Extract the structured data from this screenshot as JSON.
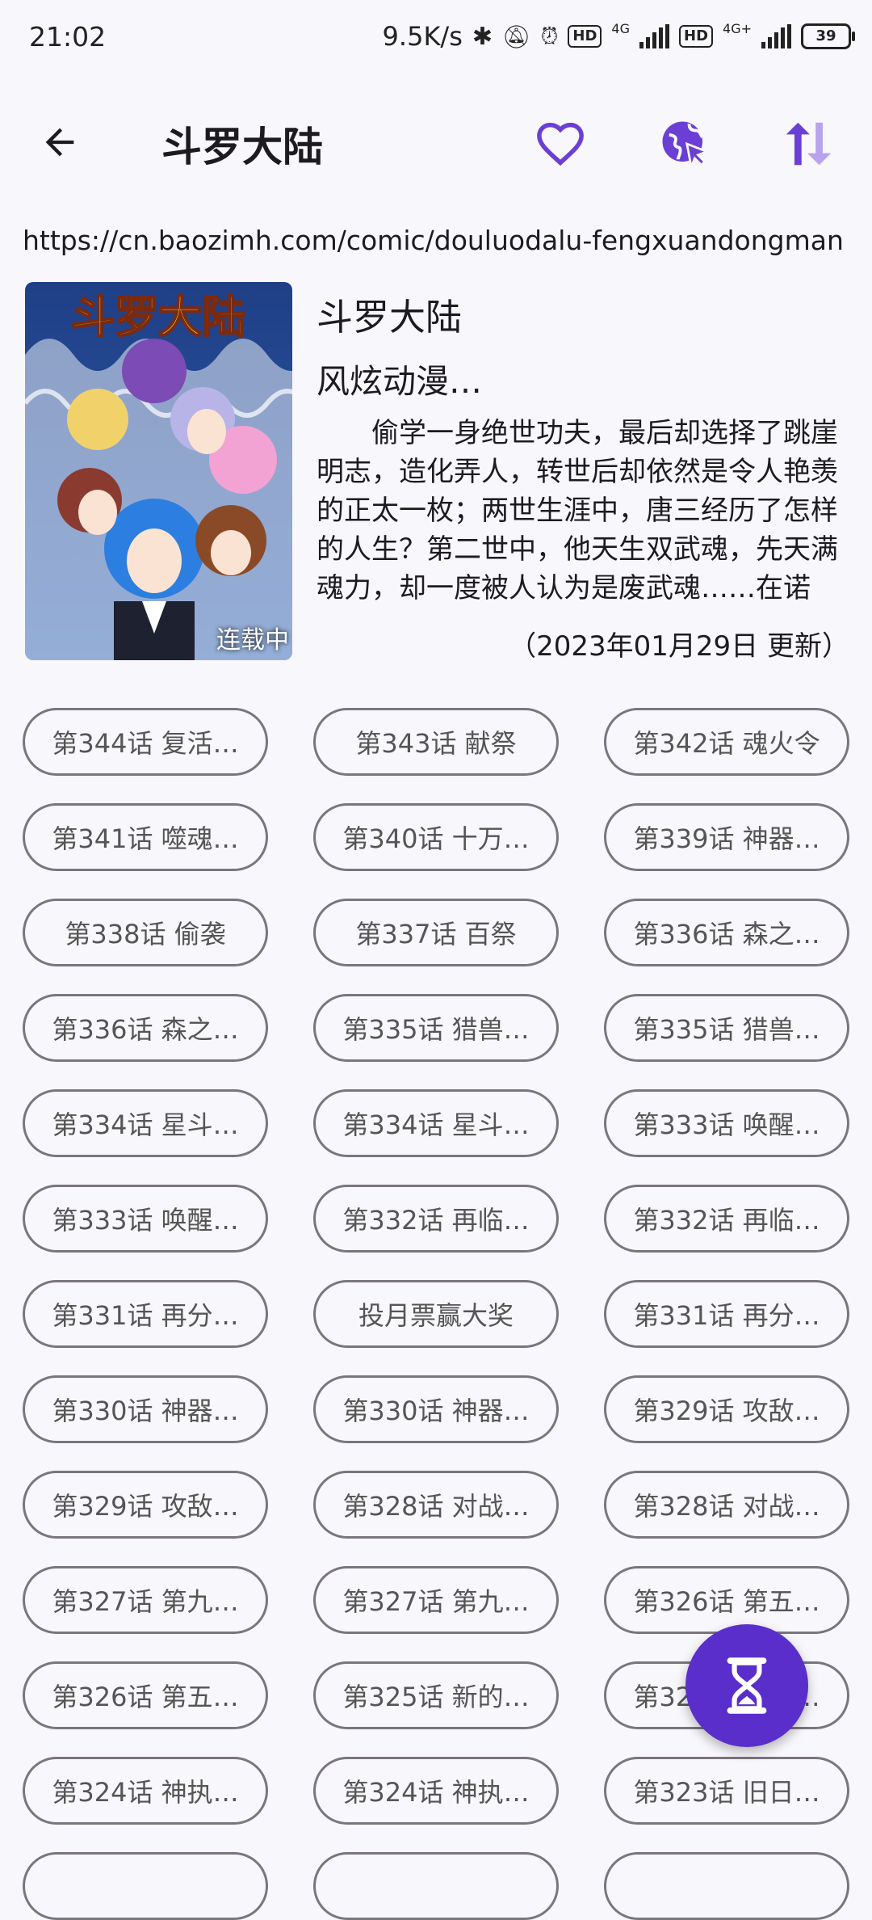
{
  "status_bar": {
    "time": "21:02",
    "net_speed": "9.5K/s",
    "hd1": "HD",
    "net1": "4G",
    "hd2": "HD",
    "net2": "4G+",
    "battery": "39"
  },
  "app_bar": {
    "title": "斗罗大陆",
    "icons": [
      "back-arrow-icon",
      "heart-icon",
      "globe-cursor-icon",
      "sort-arrows-icon"
    ]
  },
  "comic": {
    "url": "https://cn.baozimh.com/comic/douluodalu-fengxuandongman",
    "title": "斗罗大陆",
    "author": "风炫动漫…",
    "description": "偷学一身绝世功夫，最后却选择了跳崖明志，造化弄人，转世后却依然是令人艳羡的正太一枚；两世生涯中，唐三经历了怎样的人生？第二世中，他天生双武魂，先天满魂力，却一度被人认为是废武魂……在诺",
    "update": "（2023年01月29日 更新）",
    "cover_logo": "斗罗大陆",
    "cover_status": "连载中"
  },
  "chapters": [
    "第344话 复活…",
    "第343话 献祭",
    "第342话 魂火令",
    "第341话 噬魂…",
    "第340话 十万…",
    "第339话 神器…",
    "第338话 偷袭",
    "第337话 百祭",
    "第336话 森之…",
    "第336话 森之…",
    "第335话 猎兽…",
    "第335话 猎兽…",
    "第334话 星斗…",
    "第334话 星斗…",
    "第333话 唤醒…",
    "第333话 唤醒…",
    "第332话 再临…",
    "第332话 再临…",
    "第331话 再分…",
    "投月票赢大奖",
    "第331话 再分…",
    "第330话 神器…",
    "第330话 神器…",
    "第329话 攻敌…",
    "第329话 攻敌…",
    "第328话 对战…",
    "第328话 对战…",
    "第327话 第九…",
    "第327话 第九…",
    "第326话 第五…",
    "第326话 第五…",
    "第325话 新的…",
    "第325话 新的…",
    "第324话 神执…",
    "第324话 神执…",
    "第323话 旧日…",
    "",
    "",
    ""
  ],
  "colors": {
    "accent": "#5a2ecb",
    "icon_purple": "#6b3fd6"
  }
}
